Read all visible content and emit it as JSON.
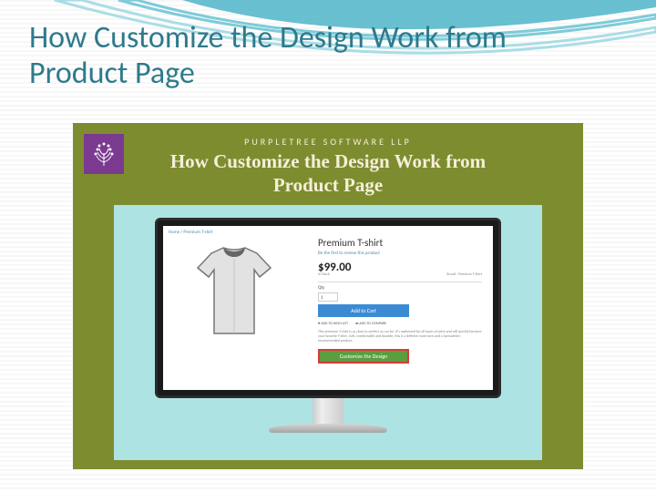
{
  "slide": {
    "title": "How Customize the Design Work from Product Page"
  },
  "embedded": {
    "company": "PURPLETREE SOFTWARE LLP",
    "title": "How Customize the Design Work from Product Page"
  },
  "product": {
    "breadcrumb": "Home / Premium T-shirt",
    "name": "Premium T-shirt",
    "review_link": "Be the first to review this product",
    "price": "$99.00",
    "stock": "In Stock",
    "brand": "Brand : Premium T-Shirt",
    "qty_label": "Qty",
    "qty_value": "1",
    "add_to_cart": "Add to Cart",
    "wishlist": "♥ ADD TO WISH LIST",
    "compare": "⇄ ADD TO COMPARE",
    "description": "This premium T-shirt is as close to perfect as can be. It's optimized for all types of print and will quickly become your favorite T-shirt. Soft, comfortable and durable, this is a definite must-own and a Spreadshirt recommended product.",
    "customize": "Customize the Design"
  }
}
